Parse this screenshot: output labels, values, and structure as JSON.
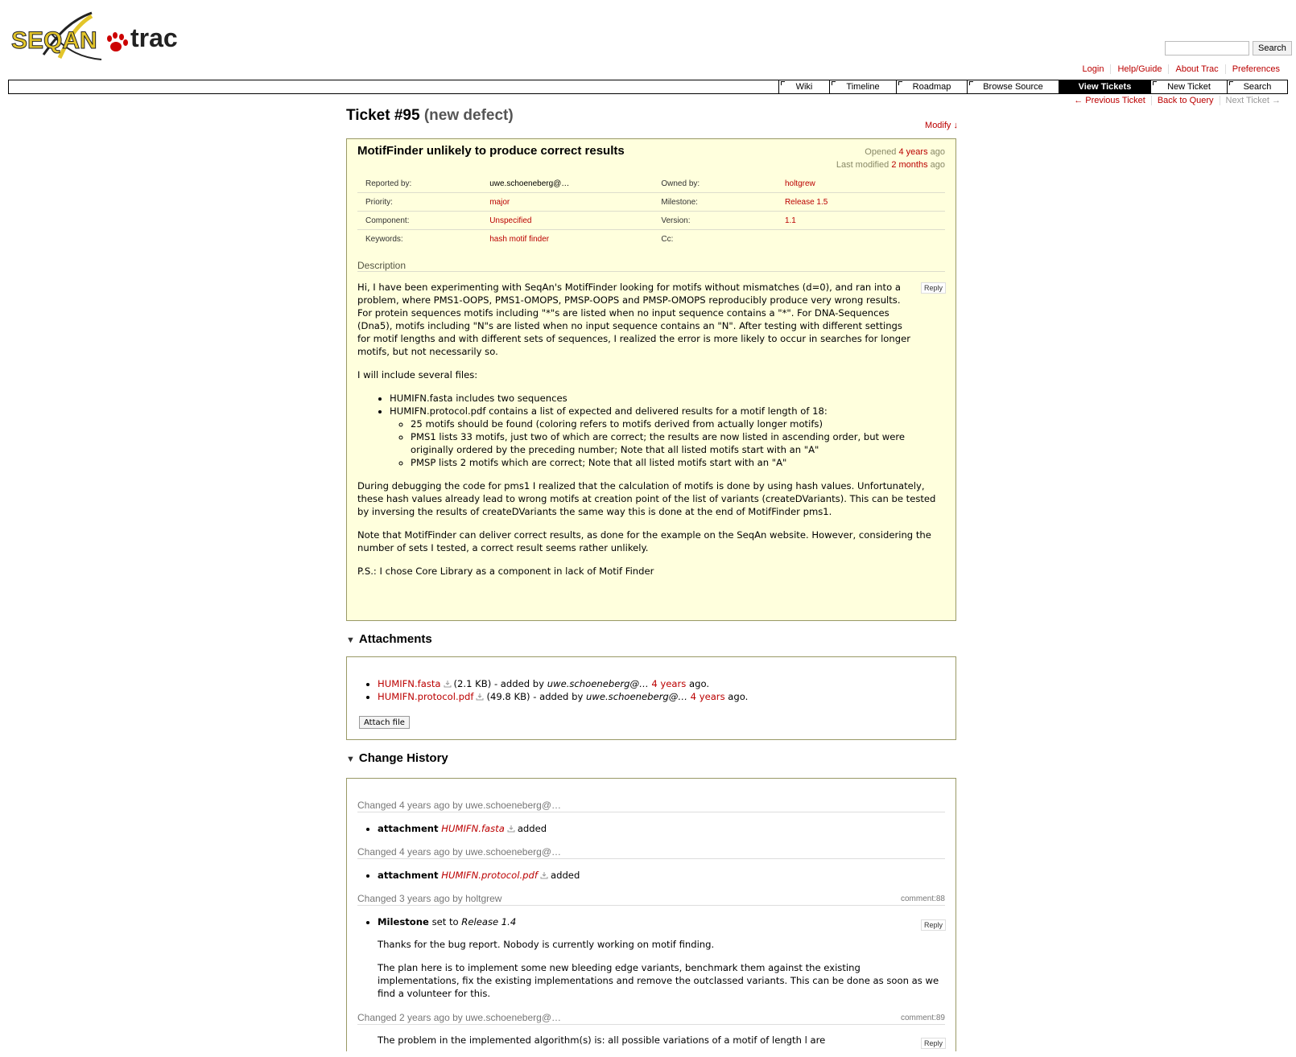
{
  "header": {
    "logo_text_seqan": "SEQAN",
    "logo_text_trac": "trac",
    "search_placeholder": "",
    "search_button": "Search"
  },
  "metanav": [
    "Login",
    "Help/Guide",
    "About Trac",
    "Preferences"
  ],
  "mainnav": {
    "tabs": [
      "Wiki",
      "Timeline",
      "Roadmap",
      "Browse Source",
      "View Tickets",
      "New Ticket",
      "Search"
    ],
    "active": "View Tickets"
  },
  "ctxtnav": {
    "previous": "← Previous Ticket",
    "back": "Back to Query",
    "next": "Next Ticket →"
  },
  "ticket": {
    "title_number": "Ticket #95",
    "title_status": "(new defect)",
    "modify_link": "Modify ↓",
    "summary": "MotifFinder unlikely to produce correct results",
    "opened_prefix": "Opened",
    "opened_age": "4 years",
    "opened_suffix": "ago",
    "modified_prefix": "Last modified",
    "modified_age": "2 months",
    "modified_suffix": "ago",
    "properties": [
      {
        "label1": "Reported by:",
        "value1": "uwe.schoeneberg@…",
        "link1": false,
        "label2": "Owned by:",
        "value2": "holtgrew",
        "link2": true
      },
      {
        "label1": "Priority:",
        "value1": "major",
        "link1": true,
        "label2": "Milestone:",
        "value2": "Release 1.5",
        "link2": true
      },
      {
        "label1": "Component:",
        "value1": "Unspecified",
        "link1": true,
        "label2": "Version:",
        "value2": "1.1",
        "link2": true
      },
      {
        "label1": "Keywords:",
        "value1": "hash motif finder",
        "link1": true,
        "label2": "Cc:",
        "value2": "",
        "link2": false
      }
    ],
    "description_heading": "Description",
    "reply_label": "Reply",
    "description": {
      "p1": "Hi, I have been experimenting with SeqAn's MotifFinder looking for motifs without mismatches (d=0), and ran into a problem, where PMS1-OOPS, PMS1-OMOPS, PMSP-OOPS and PMSP-OMOPS reproducibly produce very wrong results. For protein sequences motifs including \"*\"s are listed when no input sequence contains a \"*\". For DNA-Sequences (Dna5), motifs including \"N\"s are listed when no input sequence contains an \"N\". After testing with different settings for motif lengths and with different sets of sequences, I realized the error is more likely to occur in searches for longer motifs, but not necessarily so.",
      "p2": "I will include several files:",
      "li1": "HUMIFN.fasta includes two sequences",
      "li2": "HUMIFN.protocol.pdf contains a list of expected and delivered results for a motif length of 18:",
      "sub1": "25 motifs should be found (coloring refers to motifs derived from actually longer motifs)",
      "sub2": "PMS1 lists 33 motifs, just two of which are correct; the results are now listed in ascending order, but were originally ordered by the preceding number; Note that all listed motifs start with an \"A\"",
      "sub3": "PMSP lists 2 motifs which are correct; Note that all listed motifs start with an \"A\"",
      "p3": "During debugging the code for pms1 I realized that the calculation of motifs is done by using hash values. Unfortunately, these hash values already lead to wrong motifs at creation point of the list of variants (createDVariants). This can be tested by inversing the results of createDVariants the same way this is done at the end of MotifFinder pms1.",
      "p4": "Note that MotifFinder can deliver correct results, as done for the example on the SeqAn website. However, considering the number of sets I tested, a correct result seems rather unlikely.",
      "p5": "P.S.: I chose Core Library as a component in lack of Motif Finder"
    }
  },
  "attachments": {
    "heading": "Attachments",
    "items": [
      {
        "name": "HUMIFN.fasta",
        "size": "(2.1 KB) - added by",
        "author": "uwe.schoeneberg@…",
        "age": "4 years",
        "suffix": "ago."
      },
      {
        "name": "HUMIFN.protocol.pdf",
        "size": "(49.8 KB) - added by",
        "author": "uwe.schoeneberg@…",
        "age": "4 years",
        "suffix": "ago."
      }
    ],
    "attach_button": "Attach file"
  },
  "history": {
    "heading": "Change History",
    "changes": [
      {
        "head": "Changed 4 years ago by uwe.schoeneberg@…",
        "comment_ref": "",
        "field": "attachment",
        "value": "HUMIFN.fasta",
        "action": "added"
      },
      {
        "head": "Changed 4 years ago by uwe.schoeneberg@…",
        "comment_ref": "",
        "field": "attachment",
        "value": "HUMIFN.protocol.pdf",
        "action": "added"
      },
      {
        "head": "Changed 3 years ago by holtgrew",
        "comment_ref": "comment:88",
        "field": "Milestone",
        "set_to": "set to",
        "value": "Release 1.4",
        "p1": "Thanks for the bug report. Nobody is currently working on motif finding.",
        "p2": "The plan here is to implement some new bleeding edge variants, benchmark them against the existing implementations, fix the existing implementations and remove the outclassed variants. This can be done as soon as we find a volunteer for this."
      },
      {
        "head": "Changed 2 years ago by uwe.schoeneberg@…",
        "comment_ref": "comment:89",
        "p1": "The problem in the implemented algorithm(s) is: all possible variations of a motif of length l are"
      }
    ]
  }
}
